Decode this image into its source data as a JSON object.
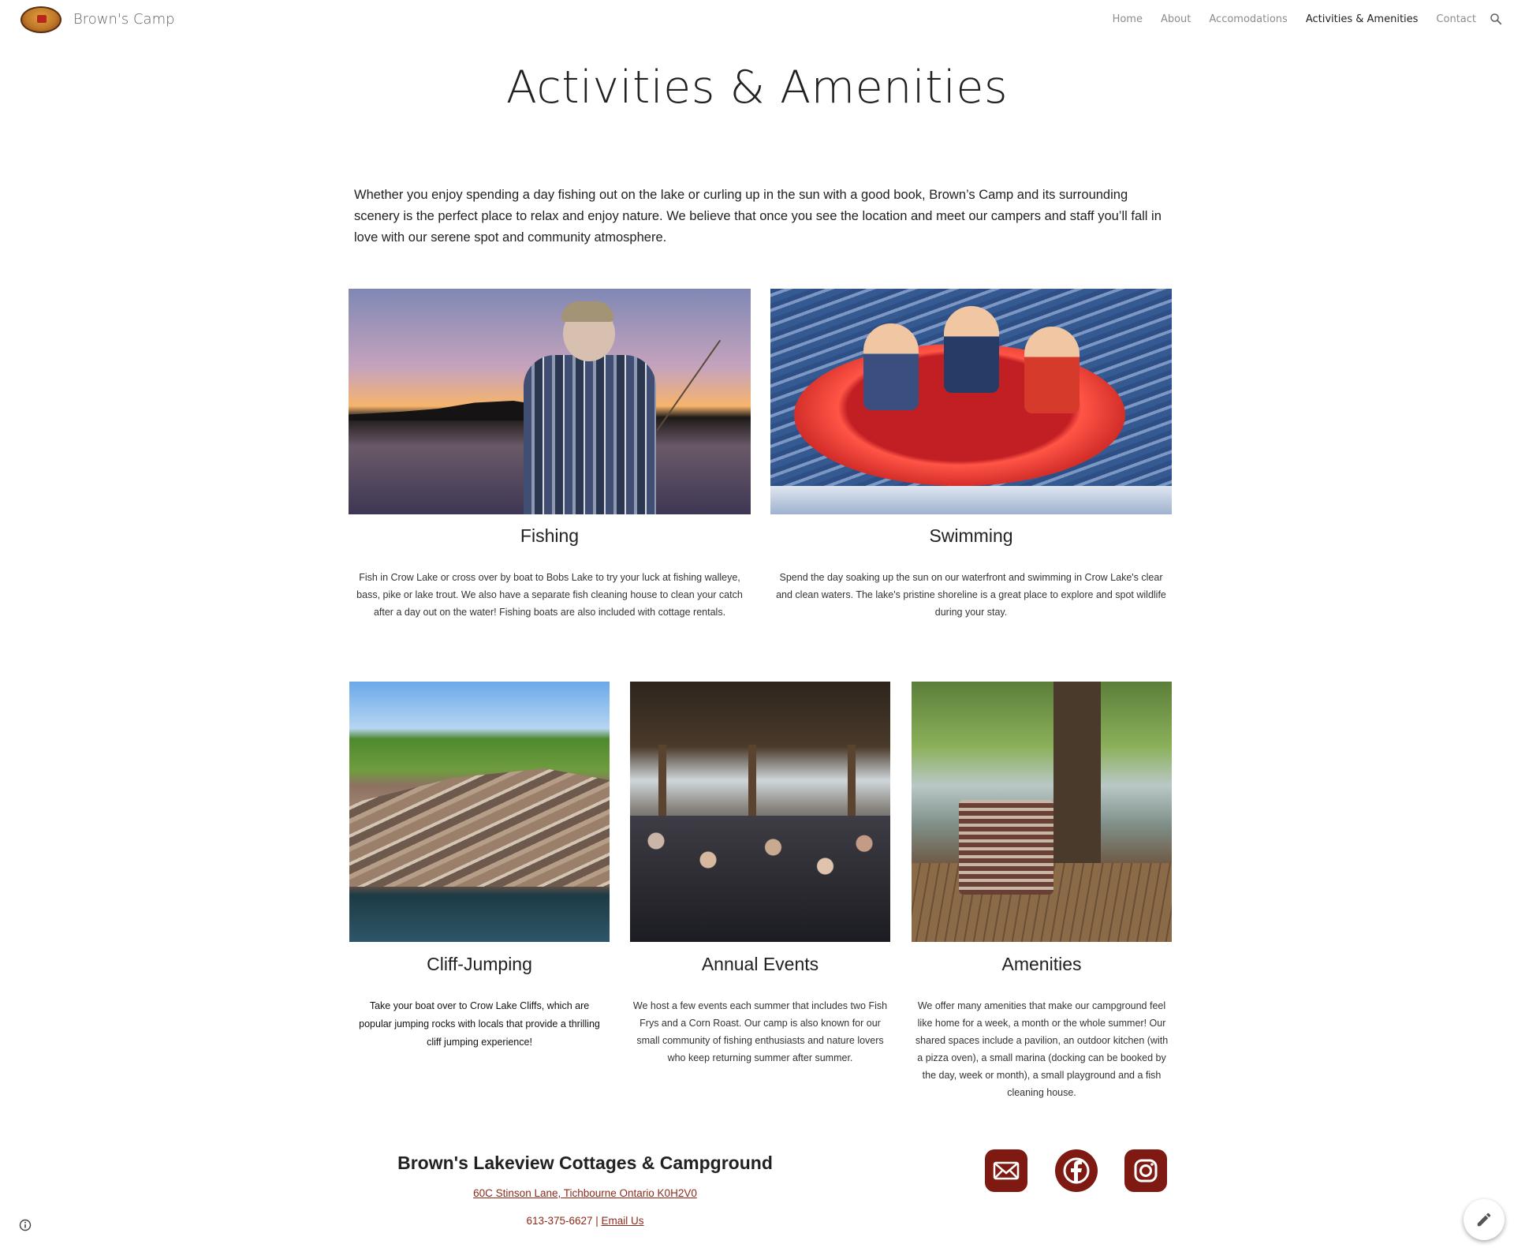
{
  "header": {
    "site_name": "Brown's Camp",
    "nav": [
      "Home",
      "About",
      "Accomodations",
      "Activities & Amenities",
      "Contact"
    ],
    "active_nav": "Activities & Amenities"
  },
  "page": {
    "title": "Activities & Amenities",
    "intro": "Whether you enjoy spending a day fishing out on the lake or curling up in the sun with a good book, Brown’s Camp and its surrounding scenery is the perfect place to relax and enjoy nature. We believe that once you see the location and meet our campers and staff you’ll fall in love with our serene spot and community atmosphere."
  },
  "cards": [
    {
      "title": "Fishing",
      "text": "Fish in Crow Lake or cross over by boat to Bobs Lake to try your luck at fishing walleye, bass, pike or lake trout. We also have a separate fish cleaning house to clean your catch after a day out on the water! Fishing boats are also included with cottage rentals."
    },
    {
      "title": "Swimming",
      "text": "Spend the day soaking up the sun on our waterfront and swimming in Crow Lake's clear and clean waters. The lake's pristine shoreline is a great place to explore and spot wildlife during your stay."
    },
    {
      "title": "Cliff-Jumping",
      "text": "Take your boat over to Crow Lake Cliffs, which are popular jumping rocks with locals that provide a thrilling cliff jumping experience!"
    },
    {
      "title": "Annual Events",
      "text": "We host a few events each summer that includes two Fish Frys and a Corn Roast. Our camp is also known for our small community of fishing enthusiasts and nature lovers who keep returning summer after summer."
    },
    {
      "title": "Amenities",
      "text": "We offer many amenities that make our campground feel like home for a week, a month or the whole summer! Our shared spaces include a pavilion, an outdoor kitchen (with a pizza oven), a small marina (docking can be booked by the day, week or month), a small playground and a fish cleaning house."
    }
  ],
  "footer": {
    "title": "Brown's Lakeview Cottages & Campground",
    "address": "60C Stinson Lane, Tichbourne Ontario K0H2V0",
    "phone": "613-375-6627",
    "separator": " | ",
    "email_label": "Email Us"
  },
  "colors": {
    "accent": "#7f1a13",
    "link": "#8b2a1a"
  },
  "icons": [
    "search-icon",
    "mail-icon",
    "facebook-icon",
    "instagram-icon",
    "info-icon",
    "pencil-icon"
  ]
}
